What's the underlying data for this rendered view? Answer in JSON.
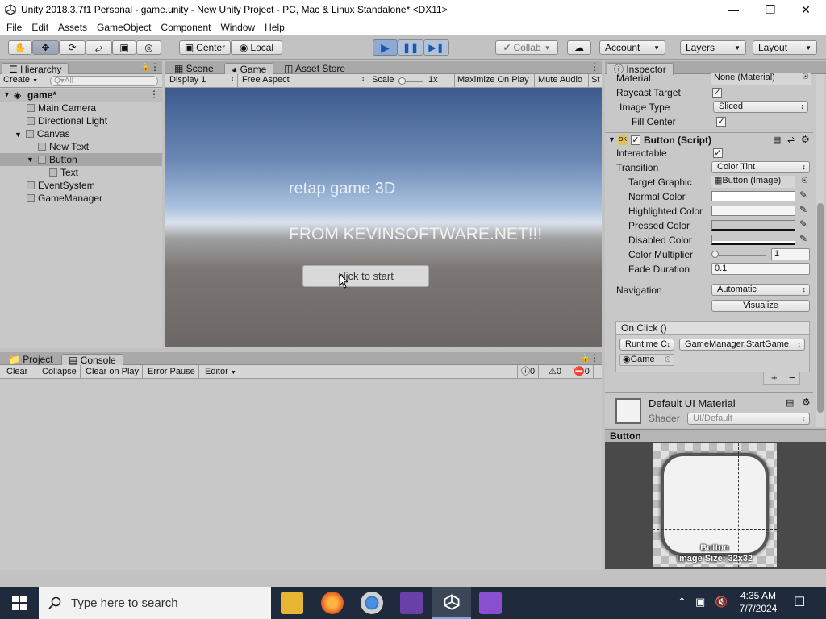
{
  "window": {
    "title": "Unity 2018.3.7f1 Personal - game.unity - New Unity Project - PC, Mac & Linux Standalone* <DX11>",
    "controls": {
      "minimize": "—",
      "maximize": "❐",
      "close": "✕"
    }
  },
  "menu": [
    "File",
    "Edit",
    "Assets",
    "GameObject",
    "Component",
    "Window",
    "Help"
  ],
  "toolbar": {
    "pivot": "Center",
    "space": "Local",
    "collab": "Collab",
    "account": "Account",
    "layers": "Layers",
    "layout": "Layout"
  },
  "hierarchy": {
    "tab": "Hierarchy",
    "create": "Create",
    "search_placeholder": "Q▾All",
    "scene": "game*",
    "items": [
      "Main Camera",
      "Directional Light",
      "Canvas",
      "New Text",
      "Button",
      "Text",
      "EventSystem",
      "GameManager"
    ]
  },
  "viewtabs": {
    "scene": "Scene",
    "game": "Game",
    "store": "Asset Store"
  },
  "gamebar": {
    "display": "Display 1",
    "aspect": "Free Aspect",
    "scale_label": "Scale",
    "scale_value": "1x",
    "maximize": "Maximize On Play",
    "mute": "Mute Audio",
    "stats": "St"
  },
  "game": {
    "title_text": "retap game 3D",
    "subtitle_text": "FROM KEVINSOFTWARE.NET!!!",
    "button_text": "click to start"
  },
  "bottomtabs": {
    "project": "Project",
    "console": "Console"
  },
  "console": {
    "clear": "Clear",
    "collapse": "Collapse",
    "clear_on_play": "Clear on Play",
    "error_pause": "Error Pause",
    "editor": "Editor",
    "info_count": "0",
    "warn_count": "0",
    "error_count": "0"
  },
  "inspector": {
    "tab": "Inspector",
    "material_label": "Material",
    "material_value": "None (Material)",
    "raycast_label": "Raycast Target",
    "image_type_label": "Image Type",
    "image_type_value": "Sliced",
    "fill_center_label": "Fill Center",
    "component_title": "Button (Script)",
    "interactable_label": "Interactable",
    "transition_label": "Transition",
    "transition_value": "Color Tint",
    "target_graphic_label": "Target Graphic",
    "target_graphic_value": "Button (Image)",
    "normal_color_label": "Normal Color",
    "highlighted_color_label": "Highlighted Color",
    "pressed_color_label": "Pressed Color",
    "disabled_color_label": "Disabled Color",
    "color_multiplier_label": "Color Multiplier",
    "color_multiplier_value": "1",
    "fade_duration_label": "Fade Duration",
    "fade_duration_value": "0.1",
    "navigation_label": "Navigation",
    "navigation_value": "Automatic",
    "visualize": "Visualize",
    "on_click": "On Click ()",
    "runtime": "Runtime C",
    "function": "GameManager.StartGame",
    "object": "Game",
    "material_name": "Default UI Material",
    "shader_label": "Shader",
    "shader_value": "UI/Default"
  },
  "preview": {
    "header": "Button",
    "name": "Button",
    "size": "Image Size: 32x32"
  },
  "taskbar": {
    "search_placeholder": "Type here to search",
    "time": "4:35 AM",
    "date": "7/7/2024"
  },
  "colors": {
    "accent_blue": "#4a7ab5",
    "taskbar": "#1f2b3c",
    "editor_gray": "#c2c2c2"
  }
}
